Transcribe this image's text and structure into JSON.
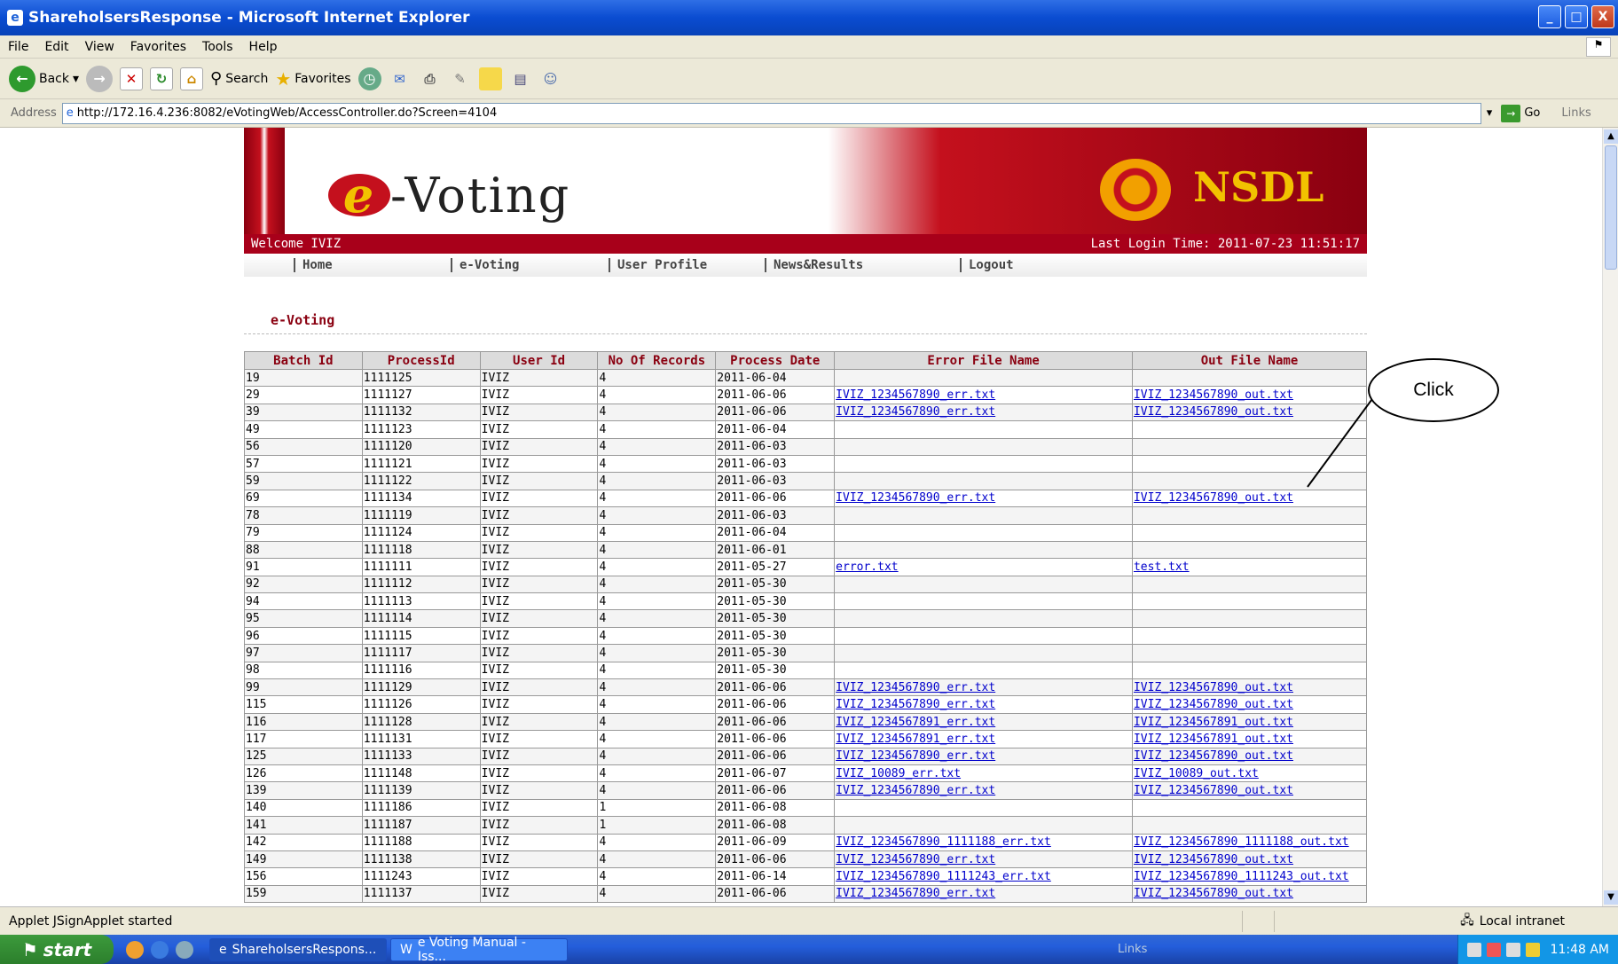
{
  "window": {
    "title": "ShareholsersResponse - Microsoft Internet Explorer",
    "buttons": [
      "_",
      "□",
      "X"
    ]
  },
  "menu": [
    "File",
    "Edit",
    "View",
    "Favorites",
    "Tools",
    "Help"
  ],
  "toolbar": {
    "back": "Back",
    "search": "Search",
    "favorites": "Favorites"
  },
  "address": {
    "label": "Address",
    "url": "http://172.16.4.236:8082/eVotingWeb/AccessController.do?Screen=4104",
    "go": "Go",
    "links": "Links"
  },
  "banner": {
    "logo_e": "e",
    "logo_rest": "-Voting",
    "brand": "NSDL",
    "welcome": "Welcome IVIZ",
    "last_login": "Last Login Time: 2011-07-23 11:51:17"
  },
  "nav": [
    "Home",
    "e-Voting",
    "User Profile",
    "News&Results",
    "Logout"
  ],
  "section_title": "e-Voting",
  "table": {
    "headers": [
      "Batch Id",
      "ProcessId",
      "User Id",
      "No Of Records",
      "Process Date",
      "Error File Name",
      "Out File Name"
    ],
    "rows": [
      [
        "19",
        "1111125",
        "IVIZ",
        "4",
        "2011-06-04",
        "",
        ""
      ],
      [
        "29",
        "1111127",
        "IVIZ",
        "4",
        "2011-06-06",
        "IVIZ_1234567890_err.txt",
        "IVIZ_1234567890_out.txt"
      ],
      [
        "39",
        "1111132",
        "IVIZ",
        "4",
        "2011-06-06",
        "IVIZ_1234567890_err.txt",
        "IVIZ_1234567890_out.txt"
      ],
      [
        "49",
        "1111123",
        "IVIZ",
        "4",
        "2011-06-04",
        "",
        ""
      ],
      [
        "56",
        "1111120",
        "IVIZ",
        "4",
        "2011-06-03",
        "",
        ""
      ],
      [
        "57",
        "1111121",
        "IVIZ",
        "4",
        "2011-06-03",
        "",
        ""
      ],
      [
        "59",
        "1111122",
        "IVIZ",
        "4",
        "2011-06-03",
        "",
        ""
      ],
      [
        "69",
        "1111134",
        "IVIZ",
        "4",
        "2011-06-06",
        "IVIZ_1234567890_err.txt",
        "IVIZ_1234567890_out.txt"
      ],
      [
        "78",
        "1111119",
        "IVIZ",
        "4",
        "2011-06-03",
        "",
        ""
      ],
      [
        "79",
        "1111124",
        "IVIZ",
        "4",
        "2011-06-04",
        "",
        ""
      ],
      [
        "88",
        "1111118",
        "IVIZ",
        "4",
        "2011-06-01",
        "",
        ""
      ],
      [
        "91",
        "1111111",
        "IVIZ",
        "4",
        "2011-05-27",
        "error.txt",
        "test.txt"
      ],
      [
        "92",
        "1111112",
        "IVIZ",
        "4",
        "2011-05-30",
        "",
        ""
      ],
      [
        "94",
        "1111113",
        "IVIZ",
        "4",
        "2011-05-30",
        "",
        ""
      ],
      [
        "95",
        "1111114",
        "IVIZ",
        "4",
        "2011-05-30",
        "",
        ""
      ],
      [
        "96",
        "1111115",
        "IVIZ",
        "4",
        "2011-05-30",
        "",
        ""
      ],
      [
        "97",
        "1111117",
        "IVIZ",
        "4",
        "2011-05-30",
        "",
        ""
      ],
      [
        "98",
        "1111116",
        "IVIZ",
        "4",
        "2011-05-30",
        "",
        ""
      ],
      [
        "99",
        "1111129",
        "IVIZ",
        "4",
        "2011-06-06",
        "IVIZ_1234567890_err.txt",
        "IVIZ_1234567890_out.txt"
      ],
      [
        "115",
        "1111126",
        "IVIZ",
        "4",
        "2011-06-06",
        "IVIZ_1234567890_err.txt",
        "IVIZ_1234567890_out.txt"
      ],
      [
        "116",
        "1111128",
        "IVIZ",
        "4",
        "2011-06-06",
        "IVIZ_1234567891_err.txt",
        "IVIZ_1234567891_out.txt"
      ],
      [
        "117",
        "1111131",
        "IVIZ",
        "4",
        "2011-06-06",
        "IVIZ_1234567891_err.txt",
        "IVIZ_1234567891_out.txt"
      ],
      [
        "125",
        "1111133",
        "IVIZ",
        "4",
        "2011-06-06",
        "IVIZ_1234567890_err.txt",
        "IVIZ_1234567890_out.txt"
      ],
      [
        "126",
        "1111148",
        "IVIZ",
        "4",
        "2011-06-07",
        "IVIZ_10089_err.txt",
        "IVIZ_10089_out.txt"
      ],
      [
        "139",
        "1111139",
        "IVIZ",
        "4",
        "2011-06-06",
        "IVIZ_1234567890_err.txt",
        "IVIZ_1234567890_out.txt"
      ],
      [
        "140",
        "1111186",
        "IVIZ",
        "1",
        "2011-06-08",
        "",
        ""
      ],
      [
        "141",
        "1111187",
        "IVIZ",
        "1",
        "2011-06-08",
        "",
        ""
      ],
      [
        "142",
        "1111188",
        "IVIZ",
        "4",
        "2011-06-09",
        "IVIZ_1234567890_1111188_err.txt",
        "IVIZ_1234567890_1111188_out.txt"
      ],
      [
        "149",
        "1111138",
        "IVIZ",
        "4",
        "2011-06-06",
        "IVIZ_1234567890_err.txt",
        "IVIZ_1234567890_out.txt"
      ],
      [
        "156",
        "1111243",
        "IVIZ",
        "4",
        "2011-06-14",
        "IVIZ_1234567890_1111243_err.txt",
        "IVIZ_1234567890_1111243_out.txt"
      ],
      [
        "159",
        "1111137",
        "IVIZ",
        "4",
        "2011-06-06",
        "IVIZ_1234567890_err.txt",
        "IVIZ_1234567890_out.txt"
      ]
    ]
  },
  "callout": "Click",
  "status": {
    "text": "Applet JSignApplet started",
    "zone": "Local intranet"
  },
  "taskbar": {
    "start": "start",
    "tasks": [
      "ShareholsersRespons...",
      "e Voting Manual - Iss..."
    ],
    "links": "Links",
    "clock": "11:48 AM"
  }
}
